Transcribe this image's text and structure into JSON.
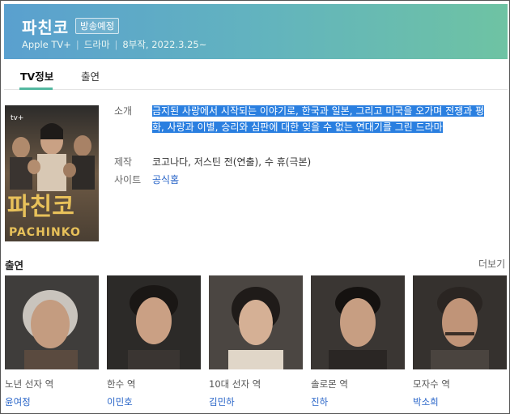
{
  "header": {
    "title": "파친코",
    "badge": "방송예정",
    "platform": "Apple TV+",
    "genre": "드라마",
    "episodes_date": "8부작, 2022.3.25~"
  },
  "tabs": [
    {
      "label": "TV정보",
      "active": true
    },
    {
      "label": "출연",
      "active": false
    }
  ],
  "poster": {
    "badge": "tv+",
    "title_ko": "파친코",
    "title_en": "PACHINKO"
  },
  "info": {
    "intro_label": "소개",
    "intro_text": "금지된 사랑에서 시작되는 이야기로, 한국과 일본, 그리고 미국을 오가며 전쟁과 평화, 사랑과 이별, 승리와 심판에 대한 잊을 수 없는 연대기를 그린 드라마",
    "production_label": "제작",
    "production_text": "코고나다, 저스틴 전(연출), 수 휴(극본)",
    "site_label": "사이트",
    "site_text": "공식홈"
  },
  "cast": {
    "heading": "출연",
    "more": "더보기",
    "members": [
      {
        "role": "노년 선자 역",
        "name": "윤여정"
      },
      {
        "role": "한수 역",
        "name": "이민호"
      },
      {
        "role": "10대 선자 역",
        "name": "김민하"
      },
      {
        "role": "솔로몬 역",
        "name": "진하"
      },
      {
        "role": "모자수 역",
        "name": "박소희"
      }
    ]
  },
  "colors": {
    "header_start": "#5aa0cf",
    "header_end": "#6ec3a3",
    "tab_accent": "#53b8a0",
    "link": "#2965c8",
    "selection": "#2a7fe0"
  }
}
